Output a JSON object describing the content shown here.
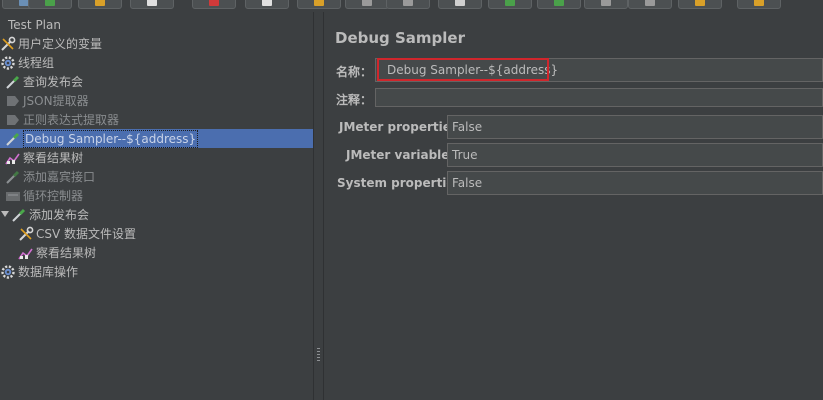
{
  "toolbar": {
    "buttons": [
      {
        "icon": "toolbar-icon-1",
        "color": "#6a8fb5"
      },
      {
        "icon": "toolbar-icon-2",
        "color": "#4aa14a"
      },
      {
        "icon": "toolbar-icon-3",
        "color": "#d9a029"
      },
      {
        "icon": "toolbar-icon-4",
        "color": "#e0e0e0"
      },
      {
        "icon": "toolbar-icon-5",
        "color": "#d03a3a"
      },
      {
        "icon": "toolbar-icon-6",
        "color": "#e0e0e0"
      },
      {
        "icon": "toolbar-icon-7",
        "color": "#d9a029"
      },
      {
        "icon": "toolbar-icon-8",
        "color": "#9a9a9a"
      },
      {
        "icon": "toolbar-icon-9",
        "color": "#9a9a9a"
      },
      {
        "icon": "toolbar-icon-10",
        "color": "#cfcfcf"
      },
      {
        "icon": "toolbar-icon-11",
        "color": "#4aa14a"
      },
      {
        "icon": "toolbar-icon-12",
        "color": "#4aa14a"
      },
      {
        "icon": "toolbar-icon-13",
        "color": "#9a9a9a"
      },
      {
        "icon": "toolbar-icon-14",
        "color": "#9a9a9a"
      },
      {
        "icon": "toolbar-icon-15",
        "color": "#d9a029"
      },
      {
        "icon": "toolbar-icon-16",
        "color": "#d9a029"
      }
    ]
  },
  "tree": {
    "items": [
      {
        "label": "Test Plan",
        "icon": "test-plan-icon",
        "disabled": false,
        "selected": false
      },
      {
        "label": "用户定义的变量",
        "icon": "wrench-icon",
        "disabled": false,
        "selected": false
      },
      {
        "label": "线程组",
        "icon": "gear-icon",
        "disabled": false,
        "selected": false
      },
      {
        "label": "查询发布会",
        "icon": "pipette-icon",
        "disabled": false,
        "selected": false
      },
      {
        "label": "JSON提取器",
        "icon": "extractor-icon",
        "disabled": true,
        "selected": false
      },
      {
        "label": "正则表达式提取器",
        "icon": "extractor-icon",
        "disabled": true,
        "selected": false
      },
      {
        "label": "Debug Sampler--${address}",
        "icon": "pipette-icon",
        "disabled": false,
        "selected": true
      },
      {
        "label": "察看结果树",
        "icon": "chart-icon",
        "disabled": false,
        "selected": false
      },
      {
        "label": "添加嘉宾接口",
        "icon": "pipette-icon",
        "disabled": true,
        "selected": false
      },
      {
        "label": "循环控制器",
        "icon": "controller-icon",
        "disabled": true,
        "selected": false
      },
      {
        "label": "添加发布会",
        "icon": "pipette-icon",
        "disabled": false,
        "selected": false
      },
      {
        "label": "CSV 数据文件设置",
        "icon": "wrench-icon",
        "disabled": false,
        "selected": false
      },
      {
        "label": "察看结果树",
        "icon": "chart-icon",
        "disabled": false,
        "selected": false
      },
      {
        "label": "数据库操作",
        "icon": "gear-icon",
        "disabled": false,
        "selected": false
      }
    ]
  },
  "panel": {
    "title": "Debug Sampler",
    "name_label": "名称：",
    "name_value": "Debug Sampler--${address}",
    "comment_label": "注释：",
    "comment_value": "",
    "properties": [
      {
        "label": "JMeter properties:",
        "value": "False"
      },
      {
        "label": "JMeter variables:",
        "value": "True"
      },
      {
        "label": "System properties:",
        "value": "False"
      }
    ]
  },
  "colors": {
    "background": "#3c3f41",
    "selection": "#4b6eaf",
    "highlight_border": "#d0262c"
  }
}
